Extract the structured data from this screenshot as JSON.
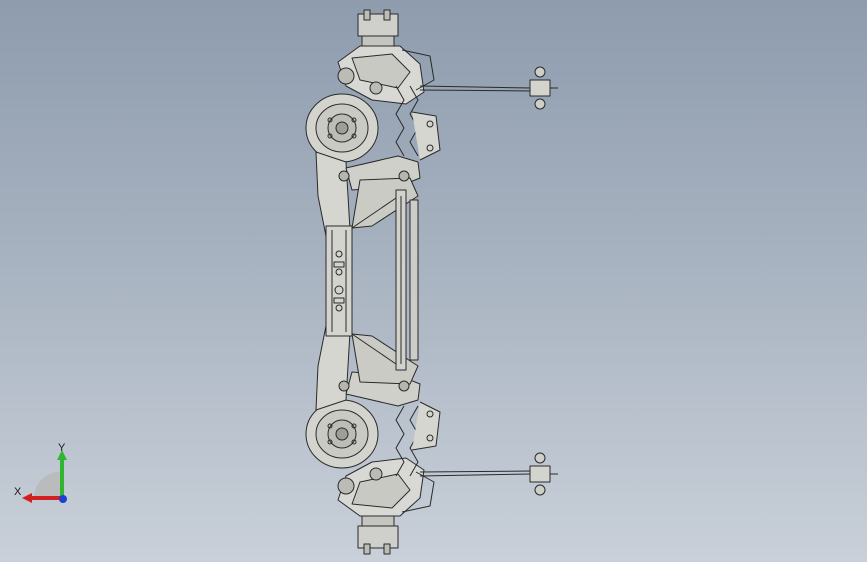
{
  "viewport": {
    "background_top": "#8e9cae",
    "background_bottom": "#c9d0d9",
    "model_color": "#2a2a2a",
    "model_fill": "#d8d8d4"
  },
  "triad": {
    "x_label": "X",
    "y_label": "Y",
    "x_color": "#d21f1f",
    "y_color": "#2fb52f",
    "z_color": "#1f3fd2"
  }
}
